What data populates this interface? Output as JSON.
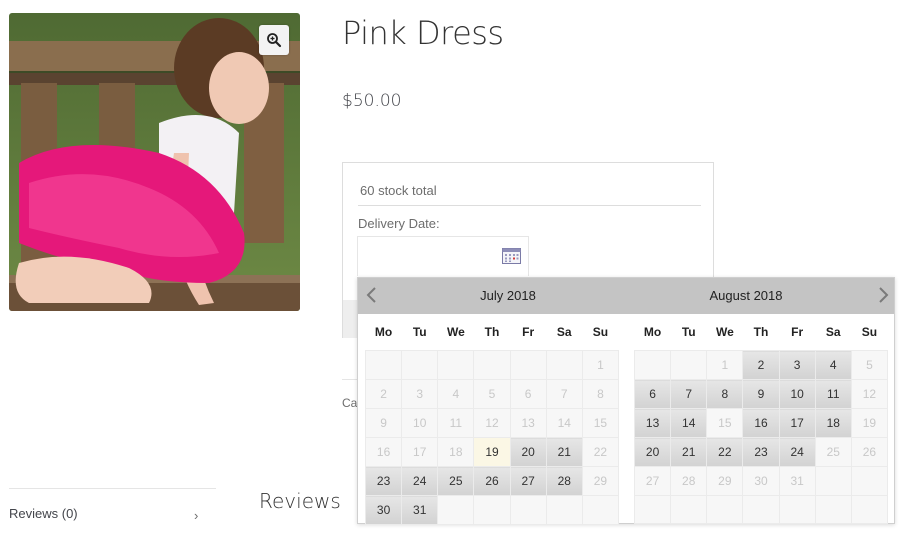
{
  "product": {
    "title": "Pink Dress",
    "price": "$50.00",
    "stock_text": "60 stock total",
    "delivery_label": "Delivery Date:",
    "category_label_partial": "Cat"
  },
  "icons": {
    "zoom": "magnifier-plus-icon",
    "calendar": "calendar-icon",
    "prev": "chevron-left-icon",
    "next": "chevron-right-icon",
    "tab_chevron": "chevron-right-icon"
  },
  "tabs": [
    {
      "label": "Reviews (0)",
      "chevron": "›"
    }
  ],
  "reviews_heading": "Reviews",
  "datepicker": {
    "weekdays": [
      "Mo",
      "Tu",
      "We",
      "Th",
      "Fr",
      "Sa",
      "Su"
    ],
    "months": [
      {
        "title": "July 2018",
        "weeks": [
          [
            null,
            null,
            null,
            null,
            null,
            null,
            {
              "d": "1",
              "s": "off"
            }
          ],
          [
            {
              "d": "2",
              "s": "off"
            },
            {
              "d": "3",
              "s": "off"
            },
            {
              "d": "4",
              "s": "off"
            },
            {
              "d": "5",
              "s": "off"
            },
            {
              "d": "6",
              "s": "off"
            },
            {
              "d": "7",
              "s": "off"
            },
            {
              "d": "8",
              "s": "off"
            }
          ],
          [
            {
              "d": "9",
              "s": "off"
            },
            {
              "d": "10",
              "s": "off"
            },
            {
              "d": "11",
              "s": "off"
            },
            {
              "d": "12",
              "s": "off"
            },
            {
              "d": "13",
              "s": "off"
            },
            {
              "d": "14",
              "s": "off"
            },
            {
              "d": "15",
              "s": "off"
            }
          ],
          [
            {
              "d": "16",
              "s": "off"
            },
            {
              "d": "17",
              "s": "off"
            },
            {
              "d": "18",
              "s": "off"
            },
            {
              "d": "19",
              "s": "today"
            },
            {
              "d": "20",
              "s": "on"
            },
            {
              "d": "21",
              "s": "on"
            },
            {
              "d": "22",
              "s": "off"
            }
          ],
          [
            {
              "d": "23",
              "s": "on"
            },
            {
              "d": "24",
              "s": "on"
            },
            {
              "d": "25",
              "s": "on"
            },
            {
              "d": "26",
              "s": "on"
            },
            {
              "d": "27",
              "s": "on"
            },
            {
              "d": "28",
              "s": "on"
            },
            {
              "d": "29",
              "s": "off"
            }
          ],
          [
            {
              "d": "30",
              "s": "on"
            },
            {
              "d": "31",
              "s": "on"
            },
            null,
            null,
            null,
            null,
            null
          ]
        ]
      },
      {
        "title": "August 2018",
        "weeks": [
          [
            null,
            null,
            {
              "d": "1",
              "s": "off"
            },
            {
              "d": "2",
              "s": "on"
            },
            {
              "d": "3",
              "s": "on"
            },
            {
              "d": "4",
              "s": "on"
            },
            {
              "d": "5",
              "s": "off"
            }
          ],
          [
            {
              "d": "6",
              "s": "on"
            },
            {
              "d": "7",
              "s": "on"
            },
            {
              "d": "8",
              "s": "on"
            },
            {
              "d": "9",
              "s": "on"
            },
            {
              "d": "10",
              "s": "on"
            },
            {
              "d": "11",
              "s": "on"
            },
            {
              "d": "12",
              "s": "off"
            }
          ],
          [
            {
              "d": "13",
              "s": "on"
            },
            {
              "d": "14",
              "s": "on"
            },
            {
              "d": "15",
              "s": "off"
            },
            {
              "d": "16",
              "s": "on"
            },
            {
              "d": "17",
              "s": "on"
            },
            {
              "d": "18",
              "s": "on"
            },
            {
              "d": "19",
              "s": "off"
            }
          ],
          [
            {
              "d": "20",
              "s": "on"
            },
            {
              "d": "21",
              "s": "on"
            },
            {
              "d": "22",
              "s": "on"
            },
            {
              "d": "23",
              "s": "on"
            },
            {
              "d": "24",
              "s": "on"
            },
            {
              "d": "25",
              "s": "off"
            },
            {
              "d": "26",
              "s": "off"
            }
          ],
          [
            {
              "d": "27",
              "s": "off"
            },
            {
              "d": "28",
              "s": "off"
            },
            {
              "d": "29",
              "s": "off"
            },
            {
              "d": "30",
              "s": "off"
            },
            {
              "d": "31",
              "s": "off"
            },
            null,
            null
          ],
          [
            null,
            null,
            null,
            null,
            null,
            null,
            null
          ]
        ]
      }
    ]
  }
}
